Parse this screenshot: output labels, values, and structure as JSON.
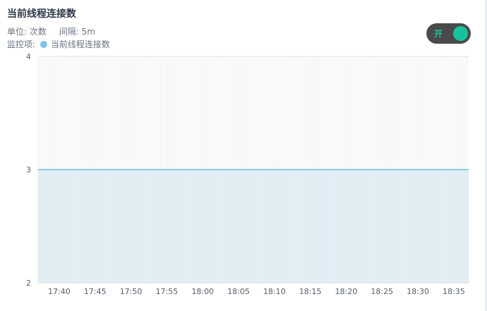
{
  "panel": {
    "title": "当前线程连接数",
    "unit_text": "单位: 次数",
    "interval_text": "间隔: 5m",
    "legend_prefix": "监控项:",
    "toggle_label": "开"
  },
  "colors": {
    "series": "#7ec3e6",
    "line": "#6dbcdf",
    "area": "#dcecf5",
    "toggle_knob": "#18c29c"
  },
  "chart_data": {
    "type": "area",
    "series": [
      {
        "name": "当前线程连接数",
        "value": 3
      }
    ],
    "x_ticks": [
      "17:40",
      "17:45",
      "17:50",
      "17:55",
      "18:00",
      "18:05",
      "18:10",
      "18:15",
      "18:20",
      "18:25",
      "18:30",
      "18:35"
    ],
    "y_ticks": [
      2,
      3,
      4
    ],
    "ylim": [
      2,
      4
    ],
    "grid": true
  }
}
